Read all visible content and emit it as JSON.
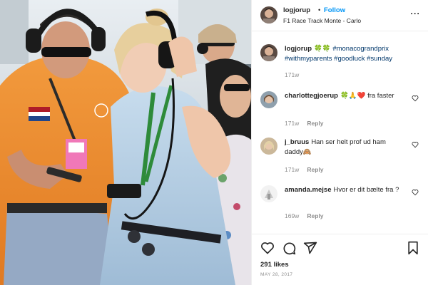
{
  "header": {
    "username": "logjorup",
    "dot": "•",
    "follow_label": "Follow",
    "location": "F1 Race Track Monte - Carlo",
    "more_label": "···"
  },
  "caption": {
    "username": "logjorup",
    "emoji": "🍀🍀",
    "hashtags": "#monacograndprix #withmyparents #goodluck #sunday",
    "age": "171w"
  },
  "comments": [
    {
      "username": "charlottegjoerup",
      "text": "🍀🙏❤️ fra faster",
      "age": "171w",
      "reply_label": "Reply"
    },
    {
      "username": "j_bruus",
      "text": "Han ser helt prof ud ham daddy🙈",
      "age": "171w",
      "reply_label": "Reply"
    },
    {
      "username": "amanda.mejse",
      "text": "Hvor er dit bælte fra ?",
      "age": "169w",
      "reply_label": "Reply"
    }
  ],
  "footer": {
    "likes": "291 likes",
    "date": "MAY 28, 2017"
  },
  "icons": {
    "like": "heart-icon",
    "comment": "comment-icon",
    "share": "share-icon",
    "save": "bookmark-icon",
    "comment_like": "small-heart-icon",
    "more": "more-icon"
  },
  "colors": {
    "follow": "#0095f6",
    "hashtag": "#00376b",
    "muted": "#8e8e8e",
    "text": "#262626",
    "divider": "#efefef"
  }
}
